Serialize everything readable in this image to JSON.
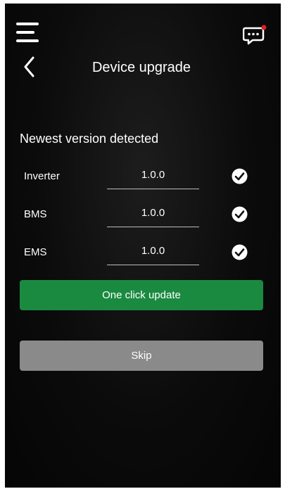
{
  "header": {
    "title": "Device upgrade",
    "menu_icon": "hamburger-menu-icon",
    "back_icon": "chevron-left-icon",
    "chat_icon": "chat-bubble-icon",
    "notification_dot_color": "#e02020"
  },
  "versions": {
    "title": "Newest version detected",
    "rows": [
      {
        "label": "Inverter",
        "value": "1.0.0",
        "status_icon": "check-circle-icon"
      },
      {
        "label": "BMS",
        "value": "1.0.0",
        "status_icon": "check-circle-icon"
      },
      {
        "label": "EMS",
        "value": "1.0.0",
        "status_icon": "check-circle-icon"
      }
    ]
  },
  "actions": {
    "update_label": "One click update",
    "update_color": "#1a8a40",
    "skip_label": "Skip",
    "skip_color": "#8a8a8a"
  }
}
